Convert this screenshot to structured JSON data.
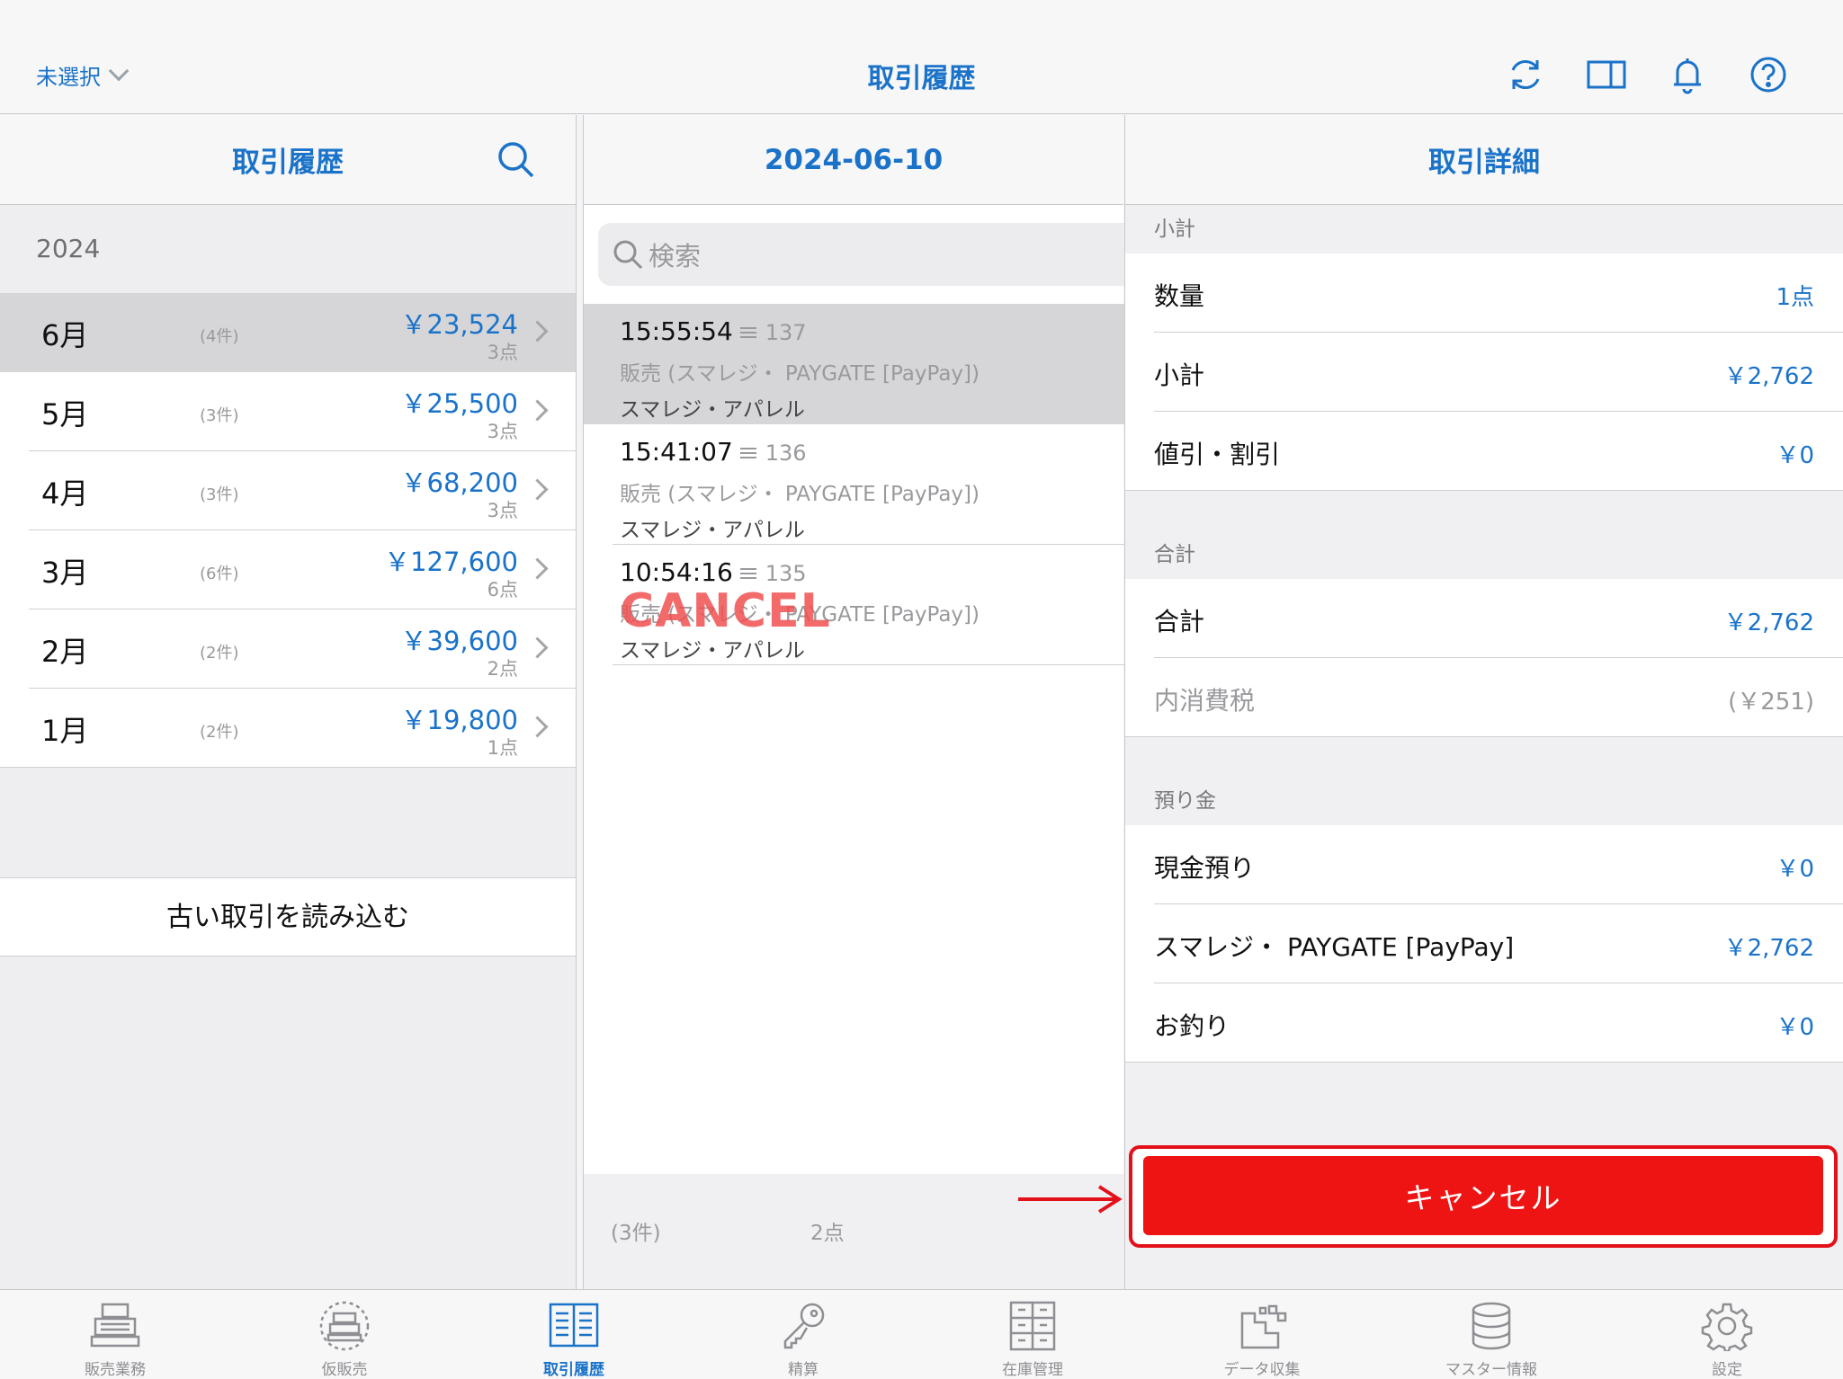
{
  "topbar": {
    "store": "未選択",
    "title": "取引履歴"
  },
  "left": {
    "header": "取引履歴",
    "year": "2024",
    "months": [
      {
        "name": "6月",
        "count": "(4件)",
        "amount": "￥23,524",
        "points": "3点",
        "selected": true
      },
      {
        "name": "5月",
        "count": "(3件)",
        "amount": "￥25,500",
        "points": "3点"
      },
      {
        "name": "4月",
        "count": "(3件)",
        "amount": "￥68,200",
        "points": "3点"
      },
      {
        "name": "3月",
        "count": "(6件)",
        "amount": "￥127,600",
        "points": "6点"
      },
      {
        "name": "2月",
        "count": "(2件)",
        "amount": "￥39,600",
        "points": "2点"
      },
      {
        "name": "1月",
        "count": "(2件)",
        "amount": "￥19,800",
        "points": "1点"
      }
    ],
    "load_old": "古い取引を読み込む"
  },
  "middle": {
    "header": "2024-06-10",
    "search_placeholder": "検索",
    "transactions": [
      {
        "time": "15:55:54",
        "number": "137",
        "payment": "販売 (スマレジ・ PAYGATE [PayPay])",
        "store": "スマレジ・アパレル",
        "selected": true
      },
      {
        "time": "15:41:07",
        "number": "136",
        "payment": "販売 (スマレジ・ PAYGATE [PayPay])",
        "store": "スマレジ・アパレル"
      },
      {
        "time": "10:54:16",
        "number": "135",
        "payment": "販売 (スマレジ・ PAYGATE [PayPay])",
        "store": "スマレジ・アパレル",
        "stamp": "CANCEL"
      }
    ],
    "footer_count": "(3件)",
    "footer_points": "2点"
  },
  "right": {
    "header": "取引詳細",
    "subtotal_section": "小計",
    "quantity_label": "数量",
    "quantity_value": "1点",
    "subtotal_label": "小計",
    "subtotal_value": "￥2,762",
    "discount_label": "値引・割引",
    "discount_value": "￥0",
    "total_section": "合計",
    "total_label": "合計",
    "total_value": "￥2,762",
    "tax_label": "内消費税",
    "tax_value": "(￥251)",
    "deposit_section": "預り金",
    "cash_label": "現金預り",
    "cash_value": "￥0",
    "paygate_label": "スマレジ・ PAYGATE [PayPay]",
    "paygate_value": "￥2,762",
    "change_label": "お釣り",
    "change_value": "￥0",
    "cancel_button": "キャンセル"
  },
  "tabs": [
    {
      "label": "販売業務",
      "icon": "register-icon"
    },
    {
      "label": "仮販売",
      "icon": "temporary-register-icon"
    },
    {
      "label": "取引履歴",
      "icon": "book-icon",
      "active": true
    },
    {
      "label": "精算",
      "icon": "key-icon"
    },
    {
      "label": "在庫管理",
      "icon": "cabinet-icon"
    },
    {
      "label": "データ収集",
      "icon": "data-collect-icon"
    },
    {
      "label": "マスター情報",
      "icon": "database-icon"
    },
    {
      "label": "設定",
      "icon": "gear-icon"
    }
  ],
  "colors": {
    "accent": "#1a73c9",
    "cancel": "#ef1414",
    "stamp": "#f05050"
  }
}
